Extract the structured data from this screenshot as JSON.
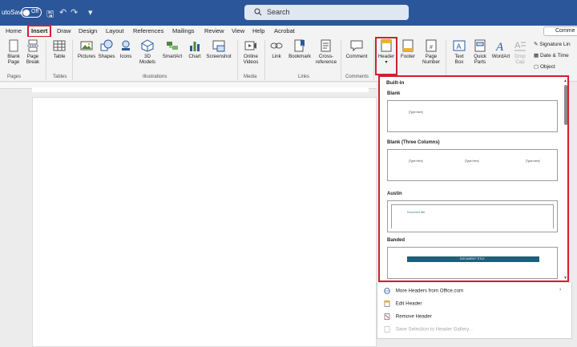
{
  "titlebar": {
    "autosave": "utoSave",
    "toggle_state": "Off",
    "search_label": "Search"
  },
  "tabs": [
    {
      "label": "Home"
    },
    {
      "label": "Insert"
    },
    {
      "label": "Draw"
    },
    {
      "label": "Design"
    },
    {
      "label": "Layout"
    },
    {
      "label": "References"
    },
    {
      "label": "Mailings"
    },
    {
      "label": "Review"
    },
    {
      "label": "View"
    },
    {
      "label": "Help"
    },
    {
      "label": "Acrobat"
    }
  ],
  "comments_btn": "Comme",
  "ribbon": {
    "blank_page": [
      "Blank",
      "Page"
    ],
    "page_break": [
      "Page",
      "Break"
    ],
    "table": "Table",
    "pictures": "Pictures",
    "shapes": "Shapes",
    "icons": "Icons",
    "models": [
      "3D",
      "Models"
    ],
    "smartart": "SmartArt",
    "chart": "Chart",
    "screenshot": "Screenshot",
    "online_videos": [
      "Online",
      "Videos"
    ],
    "link": "Link",
    "bookmark": "Bookmark",
    "cross_reference": [
      "Cross-",
      "reference"
    ],
    "comment": "Comment",
    "header": "Header",
    "footer": "Footer",
    "page_number": [
      "Page",
      "Number"
    ],
    "text_box": [
      "Text",
      "Box"
    ],
    "quick_parts": [
      "Quick",
      "Parts"
    ],
    "wordart": "WordArt",
    "drop_cap": [
      "Drop",
      "Cap"
    ],
    "signature_line": "Signature Lin",
    "date_time": "Date & Time",
    "object": "Object",
    "groups": {
      "pages": "Pages",
      "tables": "Tables",
      "illustrations": "Illustrations",
      "media": "Media",
      "links": "Links",
      "comments": "Comments"
    }
  },
  "gallery": {
    "builtin": "Built-in",
    "items": [
      {
        "title": "Blank",
        "placeholders": [
          "[Type here]"
        ]
      },
      {
        "title": "Blank (Three Columns)",
        "placeholders": [
          "[Type here]",
          "[Type here]",
          "[Type here]"
        ]
      },
      {
        "title": "Austin",
        "placeholders": [
          "Document title"
        ]
      },
      {
        "title": "Banded",
        "placeholders": [
          "DOCUMENT TITLE"
        ]
      }
    ]
  },
  "menu": {
    "more_headers": "More Headers from Office.com",
    "edit_header": "Edit Header",
    "remove_header": "Remove Header",
    "save_selection": "Save Selection to Header Gallery..."
  },
  "colors": {
    "titlebar": "#2b579a",
    "highlight": "#d0202e",
    "banded": "#1f5f7a"
  }
}
